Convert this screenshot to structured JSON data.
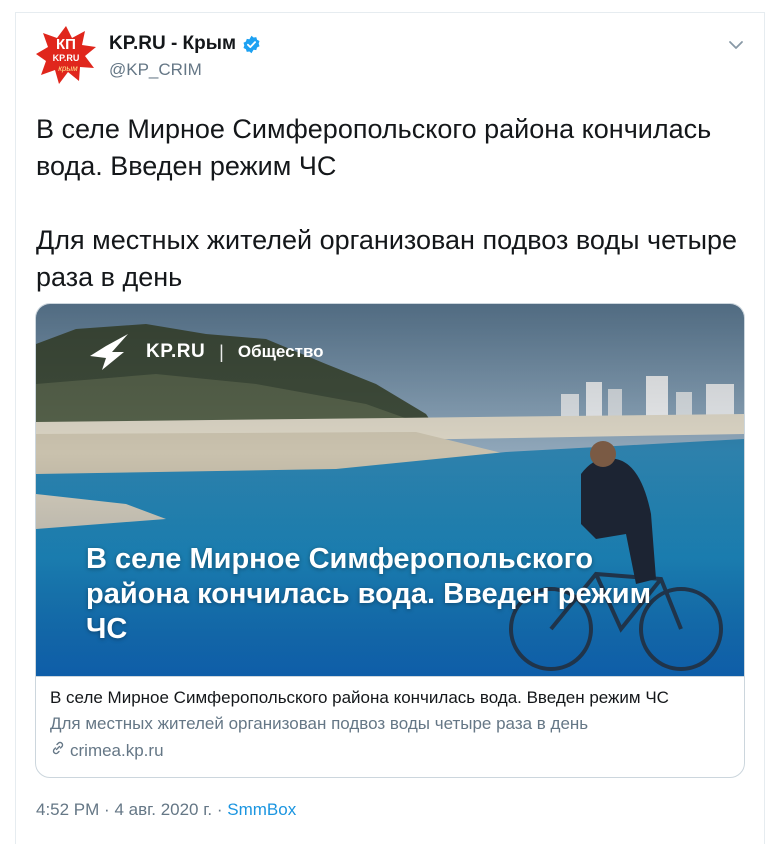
{
  "author": {
    "display_name": "KP.RU - Крым",
    "handle": "@KP_CRIM",
    "avatar_text_top": "КП",
    "avatar_text_mid": "KP.RU",
    "avatar_text_bottom": "крым",
    "verified": true
  },
  "tweet": {
    "paragraph_1": "В селе Мирное Симферопольского района кончилась вода. Введен режим ЧС",
    "paragraph_2": "Для местных жителей организован подвоз воды четыре раза в день"
  },
  "card": {
    "brand_site": "KP.RU",
    "brand_separator": "|",
    "brand_section": "Общество",
    "headline": "В селе Мирное Симферопольского района кончилась вода. Введен режим ЧС",
    "title": "В селе Мирное Симферопольского района кончилась вода. Введен режим ЧС",
    "description": "Для местных жителей организован подвоз воды четыре раза в день",
    "domain": "crimea.kp.ru"
  },
  "footer": {
    "time": "4:52 PM",
    "separator_1": "·",
    "date": "4 авг. 2020 г.",
    "separator_2": "·",
    "source": "SmmBox"
  },
  "colors": {
    "link": "#1b95e0",
    "secondary_text": "#657786",
    "verified_badge": "#1da1f2",
    "avatar_red": "#e0261c"
  },
  "icons": {
    "verified": "verified-badge-icon",
    "caret": "chevron-down-icon",
    "link": "link-icon"
  }
}
